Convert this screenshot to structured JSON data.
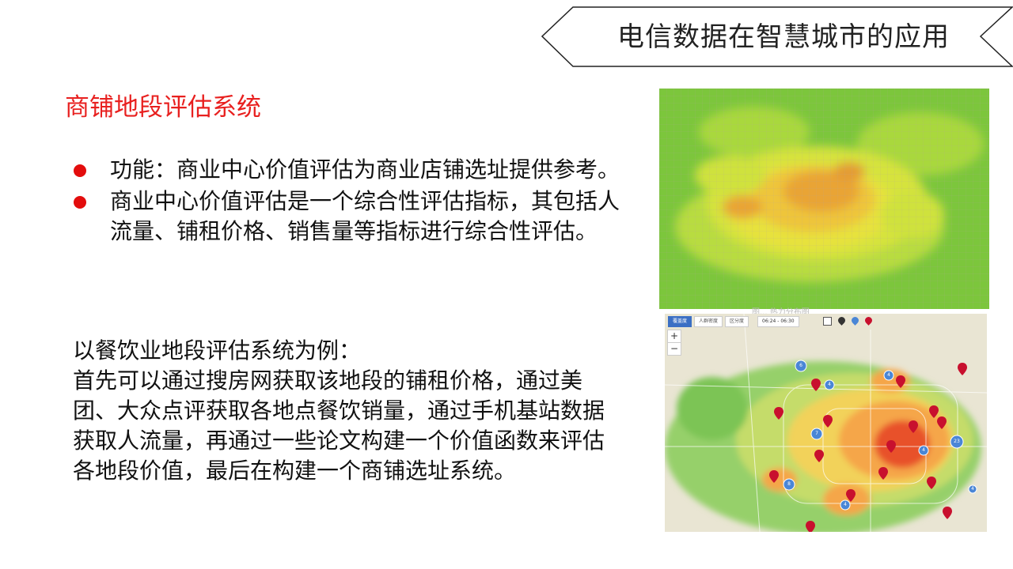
{
  "header": {
    "title": "电信数据在智慧城市的应用"
  },
  "section": {
    "title": "商铺地段评估系统"
  },
  "bullets": [
    {
      "text": "功能：商业中心价值评估为商业店铺选址提供参考。"
    },
    {
      "text": "商业中心价值评估是一个综合性评估指标，其包括人流量、铺租价格、销售量等指标进行综合性评估。"
    }
  ],
  "example": {
    "lines": [
      "以餐饮业地段评估系统为例：",
      "首先可以通过搜房网获取该地段的铺租价格，通过美团、大众点评获取各地点餐饮销量，通过手机基站数据获取人流量，再通过一些论文构建一个价值函数来评估各地段价值，最后在构建一个商铺选址系统。"
    ]
  },
  "figures": {
    "heatmap_alt": "heatmap",
    "caption": "图... 热力分布图",
    "map": {
      "tabs": [
        "覆盖度",
        "人群密度",
        "区分度"
      ],
      "time_range": "06:24 - 06:30",
      "zoom_in": "+",
      "zoom_out": "−",
      "cluster_counts": [
        "6",
        "4",
        "4",
        "7",
        "23",
        "4",
        "8",
        "4",
        "4"
      ],
      "colors": {
        "marker": "#c8102e",
        "cluster": "#4a86d6",
        "heat_high": "#e8402a",
        "heat_mid": "#f5a623",
        "heat_low": "#f6e05a",
        "green": "#8fd16a"
      }
    }
  },
  "colors": {
    "accent_red": "#e8201f",
    "bullet_red": "#e30d0d",
    "text": "#111111"
  }
}
